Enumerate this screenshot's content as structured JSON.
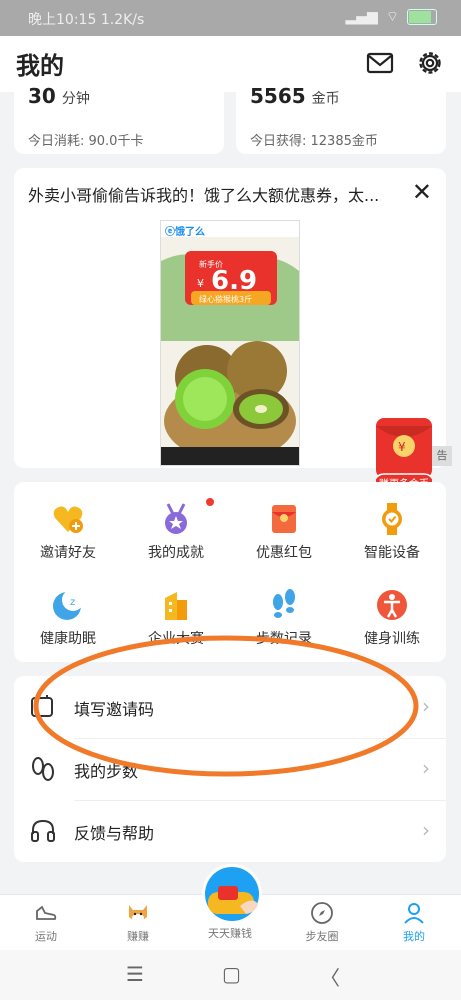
{
  "status_bar": {
    "time": "晚上10:15",
    "speed": "1.2K/s"
  },
  "header": {
    "title": "我的"
  },
  "stats": {
    "left": {
      "value": "30",
      "unit": "分钟",
      "sub": "今日消耗: 90.0千卡"
    },
    "right": {
      "value": "5565",
      "unit": "金币",
      "sub": "今日获得: 12385金币"
    }
  },
  "ad": {
    "title": "外卖小哥偷偷告诉我的！饿了么大额优惠券，太...",
    "brand": "饿了么",
    "price_prefix": "¥",
    "price": "6.9",
    "tagline": "绿心猕猴桃3斤",
    "tag_small": "新手价",
    "ad_label": "告"
  },
  "floating": {
    "red_packet_label": "赚更多金币"
  },
  "grid": [
    {
      "label": "邀请好友",
      "icon": "heart-plus-icon"
    },
    {
      "label": "我的成就",
      "icon": "medal-icon"
    },
    {
      "label": "优惠红包",
      "icon": "red-envelope-icon"
    },
    {
      "label": "智能设备",
      "icon": "smart-watch-icon"
    },
    {
      "label": "健康助眠",
      "icon": "moon-sleep-icon"
    },
    {
      "label": "企业大赛",
      "icon": "company-building-icon"
    },
    {
      "label": "步数记录",
      "icon": "footprints-icon"
    },
    {
      "label": "健身训练",
      "icon": "fitness-person-icon"
    }
  ],
  "list": [
    {
      "label": "填写邀请码",
      "icon": "invite-code-icon"
    },
    {
      "label": "我的步数",
      "icon": "steps-icon"
    },
    {
      "label": "反馈与帮助",
      "icon": "headset-icon"
    }
  ],
  "bottom_nav": [
    {
      "label": "运动",
      "icon": "sneaker-icon"
    },
    {
      "label": "赚赚",
      "icon": "shiba-dog-icon"
    },
    {
      "label": "天天赚钱",
      "icon": "coin-hand-icon"
    },
    {
      "label": "步友圈",
      "icon": "compass-icon"
    },
    {
      "label": "我的",
      "icon": "person-icon",
      "active": true
    }
  ],
  "colors": {
    "accent": "#1ea1f2",
    "ellipse": "#f07a2a",
    "red": "#e8322b",
    "orange": "#f5a623"
  }
}
